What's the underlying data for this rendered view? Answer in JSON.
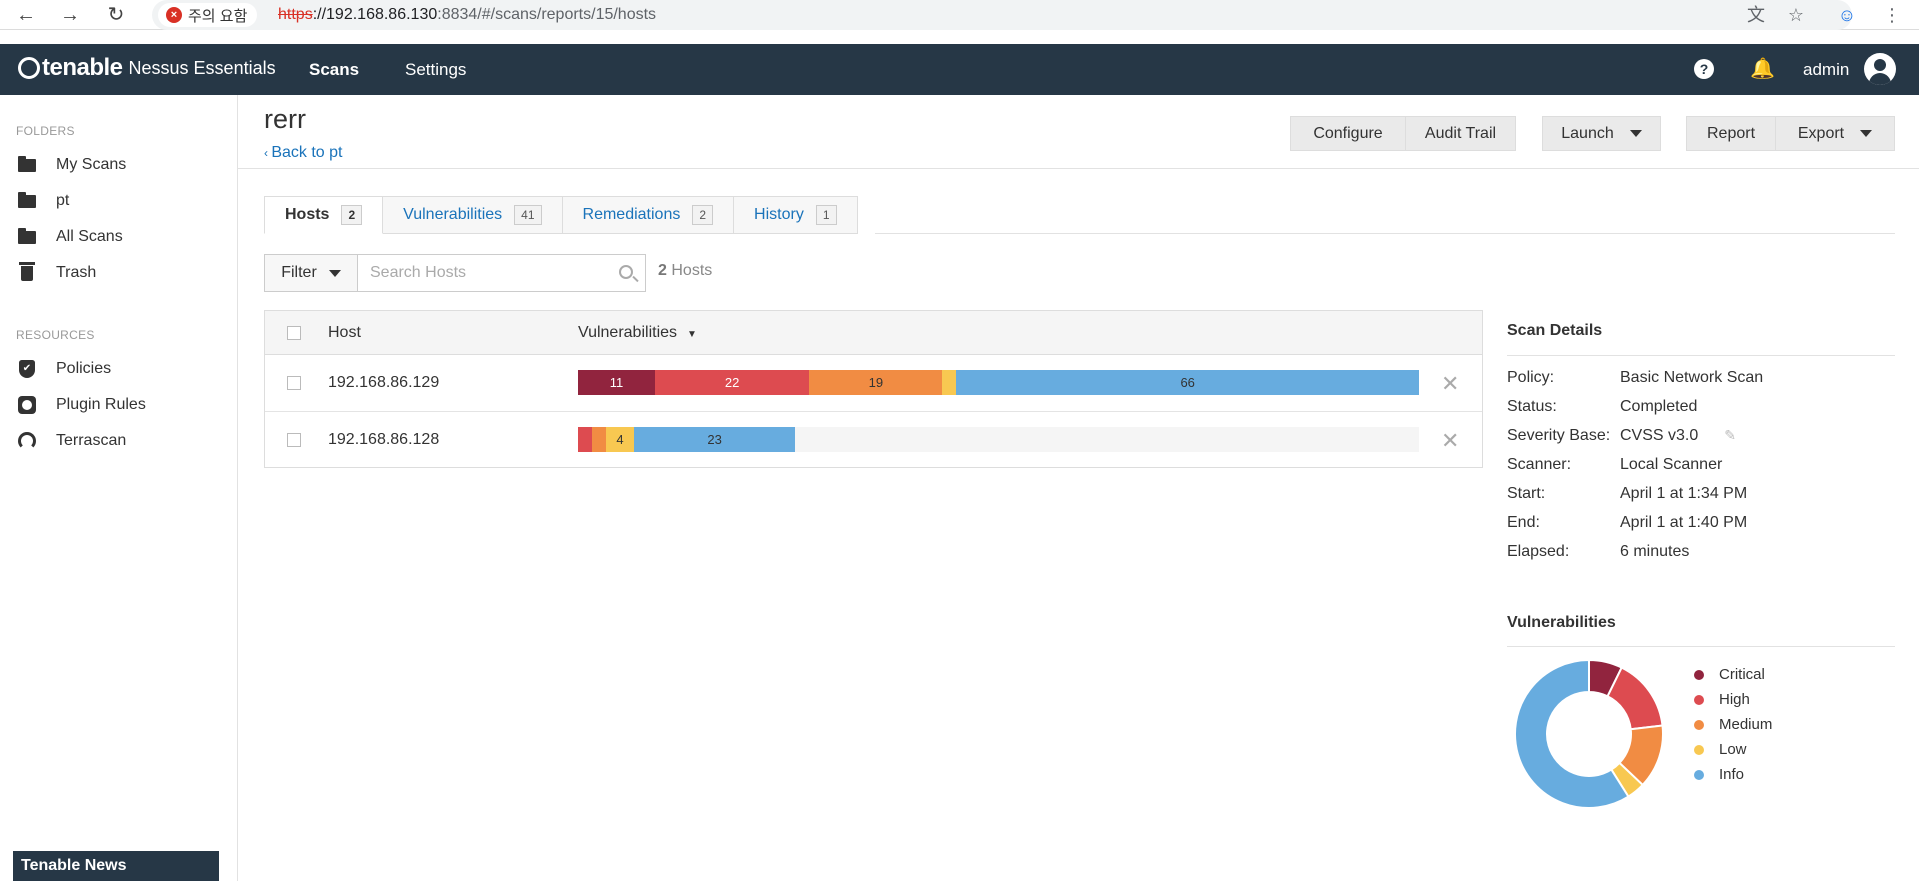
{
  "browser": {
    "security_label": "주의 요함",
    "url_scheme": "https",
    "url_host": "://192.168.86.130",
    "url_rest": ":8834/#/scans/reports/15/hosts"
  },
  "topnav": {
    "brand": "tenable",
    "product": "Nessus Essentials",
    "links": [
      "Scans",
      "Settings"
    ],
    "help": "?",
    "user": "admin"
  },
  "sidebar": {
    "folders_label": "FOLDERS",
    "folders": [
      "My Scans",
      "pt",
      "All Scans",
      "Trash"
    ],
    "resources_label": "RESOURCES",
    "resources": [
      "Policies",
      "Plugin Rules",
      "Terrascan"
    ],
    "news": "Tenable News"
  },
  "scan": {
    "title": "rerr",
    "back": "Back to pt",
    "buttons": {
      "configure": "Configure",
      "audit_trail": "Audit Trail",
      "launch": "Launch",
      "report": "Report",
      "export": "Export"
    }
  },
  "tabs": [
    {
      "label": "Hosts",
      "count": "2"
    },
    {
      "label": "Vulnerabilities",
      "count": "41"
    },
    {
      "label": "Remediations",
      "count": "2"
    },
    {
      "label": "History",
      "count": "1"
    }
  ],
  "toolbar": {
    "filter": "Filter",
    "search_placeholder": "Search Hosts",
    "host_count": "2",
    "host_count_label": "Hosts"
  },
  "table": {
    "headers": {
      "host": "Host",
      "vulns": "Vulnerabilities"
    },
    "rows": [
      {
        "host": "192.168.86.129",
        "segments": [
          {
            "severity": "critical",
            "count": 11,
            "label": "11"
          },
          {
            "severity": "high",
            "count": 22,
            "label": "22"
          },
          {
            "severity": "medium",
            "count": 19,
            "label": "19"
          },
          {
            "severity": "low",
            "count": 2,
            "label": ""
          },
          {
            "severity": "info",
            "count": 66,
            "label": "66"
          }
        ]
      },
      {
        "host": "192.168.86.128",
        "segments": [
          {
            "severity": "high",
            "count": 2,
            "label": ""
          },
          {
            "severity": "medium",
            "count": 2,
            "label": ""
          },
          {
            "severity": "low",
            "count": 4,
            "label": "4"
          },
          {
            "severity": "info",
            "count": 23,
            "label": "23"
          }
        ]
      }
    ]
  },
  "scan_details": {
    "title": "Scan Details",
    "rows": [
      {
        "label": "Policy:",
        "value": "Basic Network Scan"
      },
      {
        "label": "Status:",
        "value": "Completed"
      },
      {
        "label": "Severity Base:",
        "value": "CVSS v3.0"
      },
      {
        "label": "Scanner:",
        "value": "Local Scanner"
      },
      {
        "label": "Start:",
        "value": "April 1 at 1:34 PM"
      },
      {
        "label": "End:",
        "value": "April 1 at 1:40 PM"
      },
      {
        "label": "Elapsed:",
        "value": "6 minutes"
      }
    ]
  },
  "vuln_chart": {
    "title": "Vulnerabilities",
    "legend": [
      {
        "name": "Critical",
        "color": "#91243e"
      },
      {
        "name": "High",
        "color": "#dd4b50"
      },
      {
        "name": "Medium",
        "color": "#f18c43"
      },
      {
        "name": "Low",
        "color": "#f8c851"
      },
      {
        "name": "Info",
        "color": "#67acdf"
      }
    ]
  },
  "chart_data": {
    "type": "pie",
    "categories": [
      "Critical",
      "High",
      "Medium",
      "Low",
      "Info"
    ],
    "values": [
      11,
      24,
      21,
      6,
      89
    ],
    "title": "Vulnerabilities"
  },
  "colors": {
    "critical": "#91243e",
    "high": "#dd4b50",
    "medium": "#f18c43",
    "low": "#f8c851",
    "info": "#67acdf",
    "nav": "#263746",
    "link": "#1a73ba"
  }
}
